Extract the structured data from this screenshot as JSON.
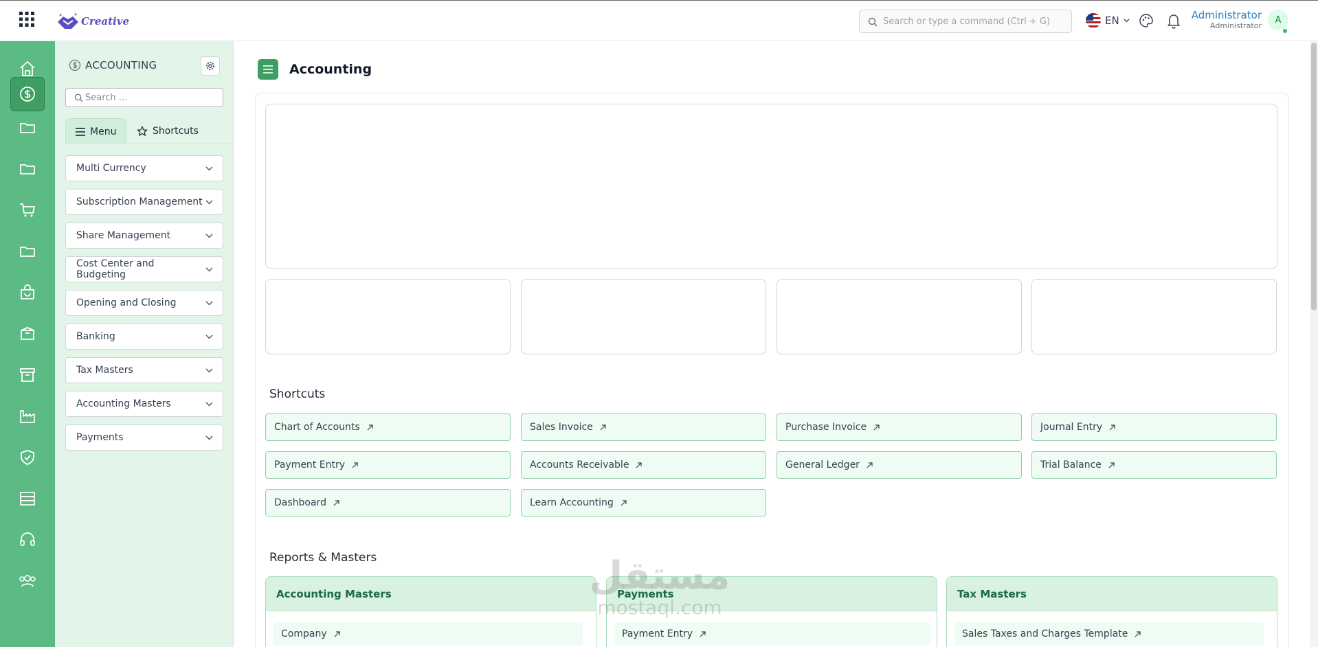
{
  "app": {
    "logo_text": "Creative",
    "search_placeholder": "Search or type a command (Ctrl + G)",
    "language": "EN",
    "user_name": "Administrator",
    "user_role": "Administrator",
    "avatar_initial": "A"
  },
  "rail": {
    "icons": [
      "home-icon",
      "dollar-circle-icon",
      "folder-icon",
      "folder-icon",
      "cart-icon",
      "folder-icon",
      "shopping-bag-icon",
      "box-icon",
      "archive-icon",
      "factory-icon",
      "shield-check-icon",
      "server-icon",
      "headset-icon",
      "users-icon"
    ],
    "active_index": 1
  },
  "sidebar": {
    "title": "ACCOUNTING",
    "search_placeholder": "Search ...",
    "tabs": [
      {
        "label": "Menu",
        "icon": "list-icon",
        "active": true
      },
      {
        "label": "Shortcuts",
        "icon": "star-icon",
        "active": false
      }
    ],
    "items": [
      {
        "label": "Multi Currency"
      },
      {
        "label": "Subscription Management"
      },
      {
        "label": "Share Management"
      },
      {
        "label": "Cost Center and Budgeting"
      },
      {
        "label": "Opening and Closing"
      },
      {
        "label": "Banking"
      },
      {
        "label": "Tax Masters"
      },
      {
        "label": "Accounting Masters"
      },
      {
        "label": "Payments"
      }
    ]
  },
  "main": {
    "title": "Accounting",
    "shortcuts_title": "Shortcuts",
    "shortcuts": [
      {
        "label": "Chart of Accounts"
      },
      {
        "label": "Sales Invoice"
      },
      {
        "label": "Purchase Invoice"
      },
      {
        "label": "Journal Entry"
      },
      {
        "label": "Payment Entry"
      },
      {
        "label": "Accounts Receivable"
      },
      {
        "label": "General Ledger"
      },
      {
        "label": "Trial Balance"
      },
      {
        "label": "Dashboard"
      },
      {
        "label": "Learn Accounting"
      }
    ],
    "reports_title": "Reports & Masters",
    "report_cards": [
      {
        "title": "Accounting Masters",
        "first_link": "Company"
      },
      {
        "title": "Payments",
        "first_link": "Payment Entry"
      },
      {
        "title": "Tax Masters",
        "first_link": "Sales Taxes and Charges Template"
      }
    ]
  },
  "watermark": {
    "arabic": "مستقل",
    "latin": "mostaql.com"
  },
  "colors": {
    "rail": "#5cba84",
    "sidebar": "#e3f5e8",
    "accent": "#3f9e63",
    "shortcut_bg": "#eefcf3",
    "report_head": "#d9f1e1"
  }
}
